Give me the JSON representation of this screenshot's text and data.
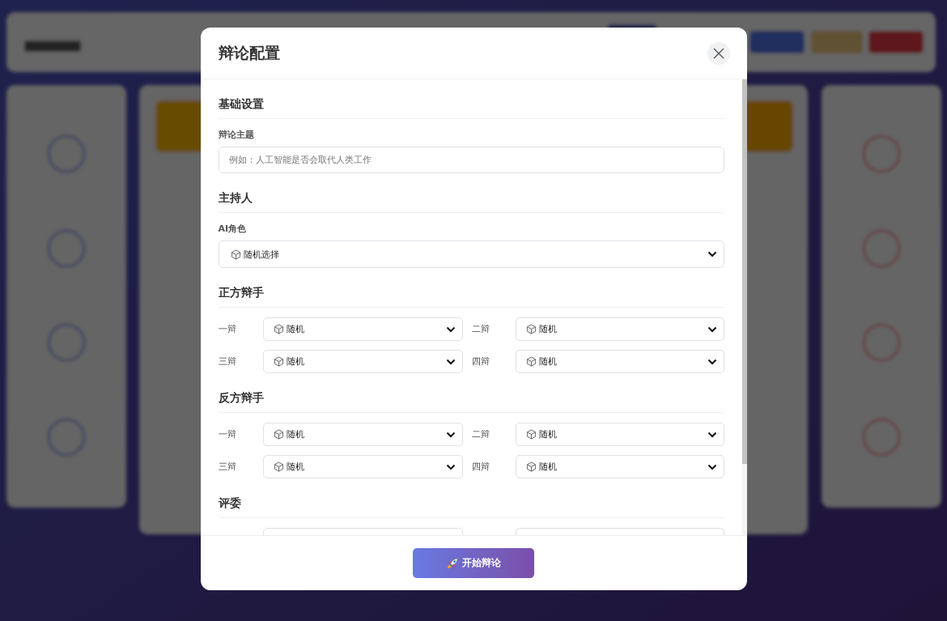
{
  "dialog": {
    "title": "辩论配置"
  },
  "sections": [
    {
      "kind": "fields",
      "title": "基础设置",
      "fields": [
        {
          "kind": "text",
          "label": "辩论主题",
          "placeholder": "例如：人工智能是否会取代人类工作"
        }
      ]
    },
    {
      "kind": "fields",
      "title": "主持人",
      "fields": [
        {
          "kind": "select",
          "label": "AI角色",
          "value": "随机选择"
        }
      ]
    },
    {
      "kind": "grid",
      "title": "正方辩手",
      "slots": [
        {
          "kind": "select",
          "label": "一辩",
          "value": "随机"
        },
        {
          "kind": "select",
          "label": "二辩",
          "value": "随机"
        },
        {
          "kind": "select",
          "label": "三辩",
          "value": "随机"
        },
        {
          "kind": "select",
          "label": "四辩",
          "value": "随机"
        }
      ]
    },
    {
      "kind": "grid",
      "title": "反方辩手",
      "slots": [
        {
          "kind": "select",
          "label": "一辩",
          "value": "随机"
        },
        {
          "kind": "select",
          "label": "二辩",
          "value": "随机"
        },
        {
          "kind": "select",
          "label": "三辩",
          "value": "随机"
        },
        {
          "kind": "select",
          "label": "四辩",
          "value": "随机"
        }
      ]
    },
    {
      "kind": "grid",
      "title": "评委",
      "slots": [
        {
          "kind": "hidden"
        },
        {
          "kind": "hidden"
        }
      ]
    }
  ],
  "footer": {
    "button": "开始辩论"
  }
}
